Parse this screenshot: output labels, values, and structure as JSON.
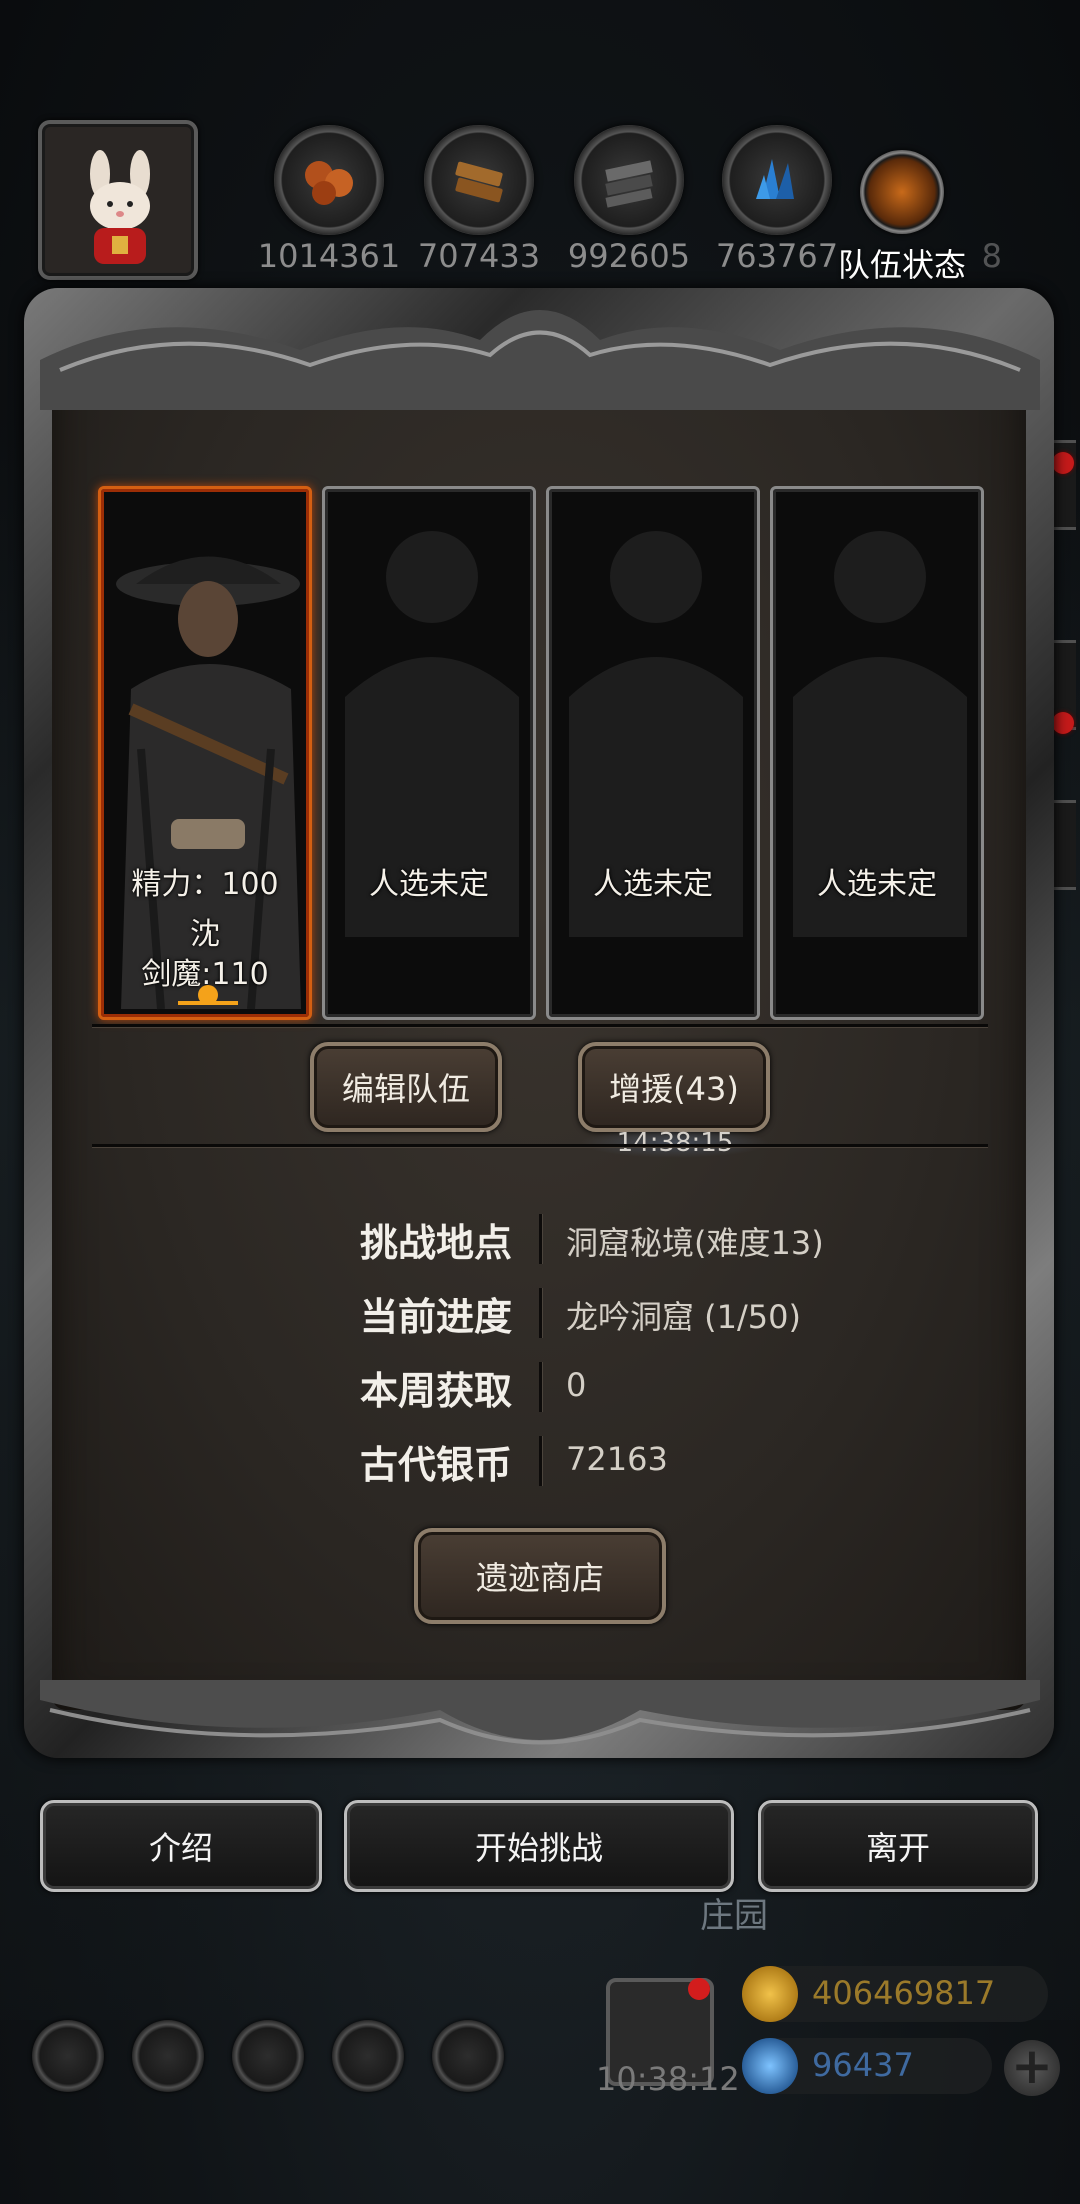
{
  "resources": [
    {
      "icon": "meat-icon",
      "value": "1014361"
    },
    {
      "icon": "wood-icon",
      "value": "707433"
    },
    {
      "icon": "iron-icon",
      "value": "992605"
    },
    {
      "icon": "crystal-icon",
      "value": "763767"
    }
  ],
  "team_status_label": "队伍状态",
  "team_status_hidden_value": "8",
  "slots": [
    {
      "stamina": "精力：100",
      "surname": "沈",
      "title": "剑魔:110"
    },
    {
      "label": "人选未定"
    },
    {
      "label": "人选未定"
    },
    {
      "label": "人选未定"
    }
  ],
  "buttons": {
    "edit_team": "编辑队伍",
    "reinforce": "增援(43)",
    "reinforce_timer": "14:38:15",
    "relic_shop": "遗迹商店",
    "intro": "介绍",
    "start_challenge": "开始挑战",
    "leave": "离开"
  },
  "info": [
    {
      "key": "挑战地点",
      "value": "洞窟秘境(难度13)"
    },
    {
      "key": "当前进度",
      "value": "龙吟洞窟 (1/50)"
    },
    {
      "key": "本周获取",
      "value": "0"
    },
    {
      "key": "古代银币",
      "value": "72163"
    }
  ],
  "estate_label": "庄园",
  "footer": {
    "clock": "10:38:12",
    "gold": "406469817",
    "gems": "96437",
    "plus": "+"
  },
  "colors": {
    "active_slot_border": "#d45f12",
    "gold_text": "#9b7a2a",
    "gem_text": "#3f6aa0"
  }
}
